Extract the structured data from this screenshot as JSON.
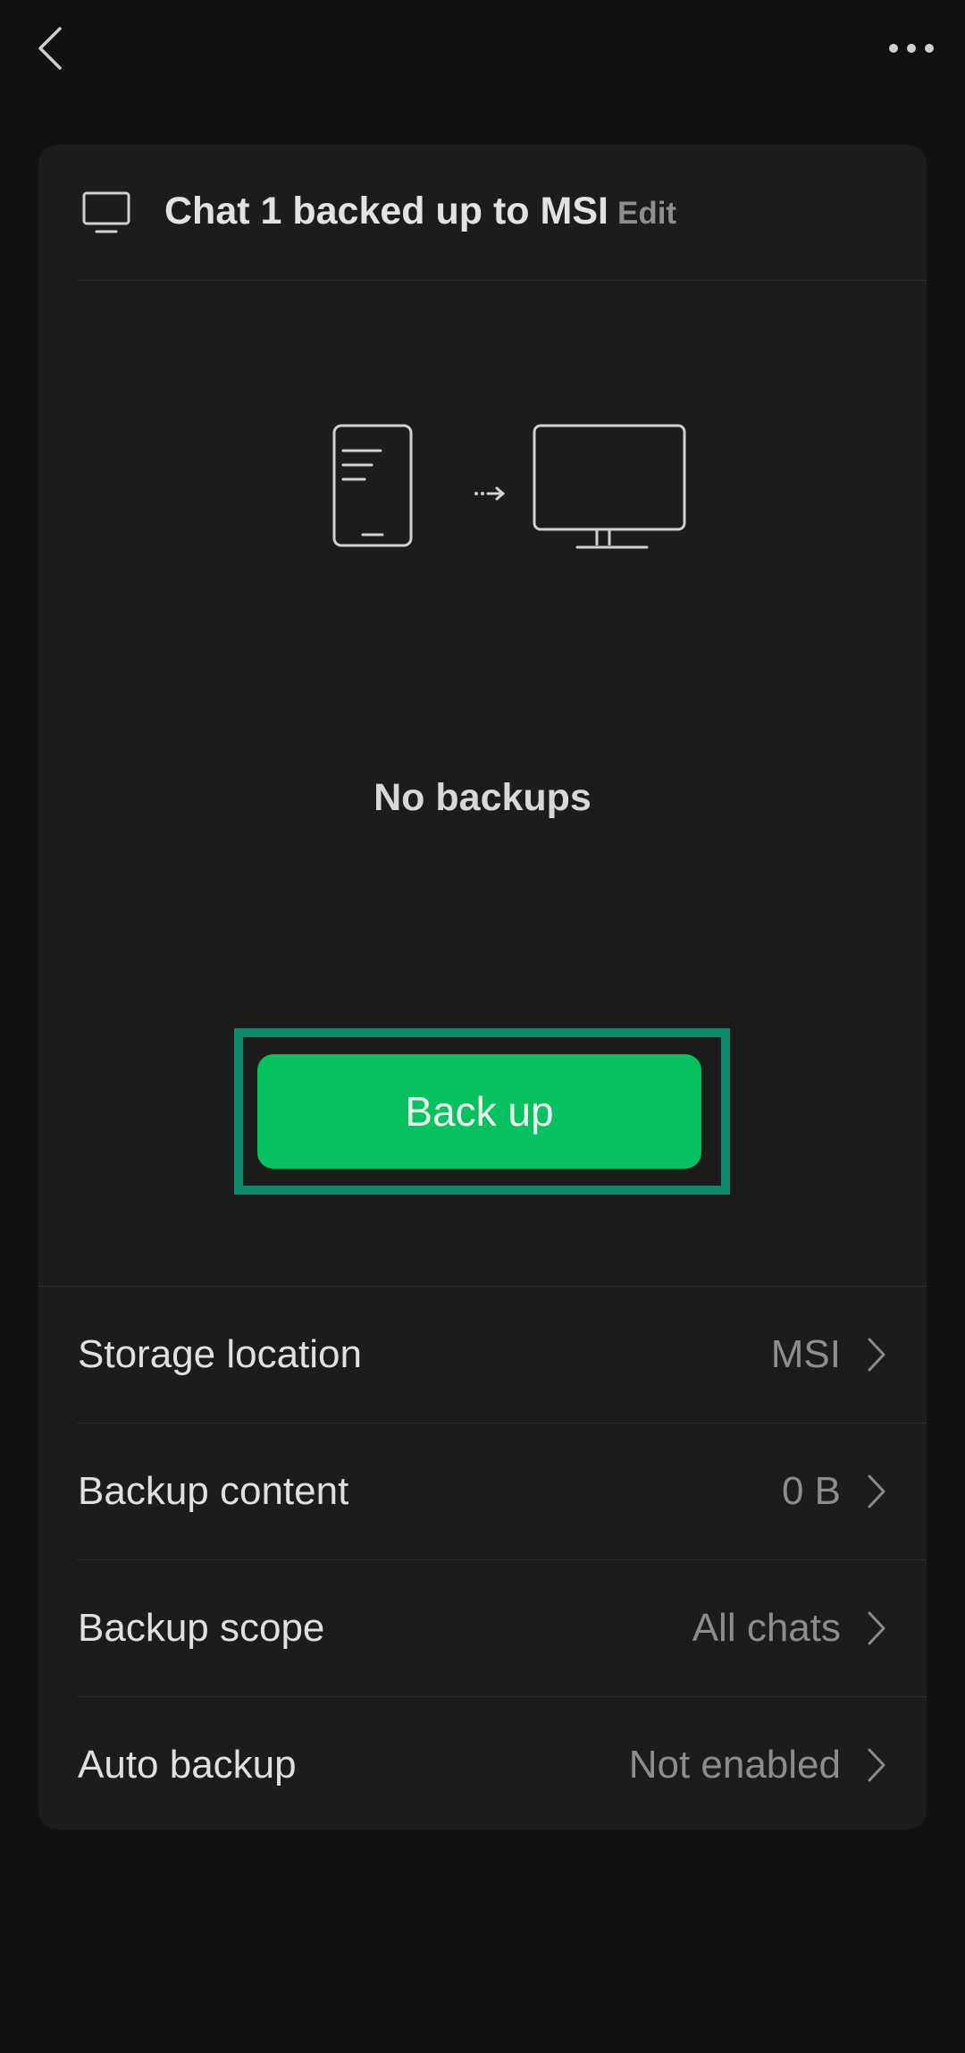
{
  "topbar": {
    "back_icon": "chevron-left-icon",
    "more_icon": "more-horizontal-icon"
  },
  "card": {
    "header": {
      "icon": "monitor-icon",
      "title": "Chat 1 backed up to MSI",
      "edit_label": "Edit"
    },
    "illustration": {
      "icons": [
        "phone-icon",
        "arrow-right-icon",
        "monitor-icon"
      ]
    },
    "empty_label": "No backups",
    "backup_button_label": "Back up",
    "settings": [
      {
        "label": "Storage location",
        "value": "MSI"
      },
      {
        "label": "Backup content",
        "value": "0 B"
      },
      {
        "label": "Backup scope",
        "value": "All chats"
      },
      {
        "label": "Auto backup",
        "value": "Not enabled"
      }
    ]
  },
  "colors": {
    "background": "#111111",
    "card": "#1c1c1c",
    "accent_green": "#07c160",
    "highlight_frame": "#0a8a6a"
  }
}
